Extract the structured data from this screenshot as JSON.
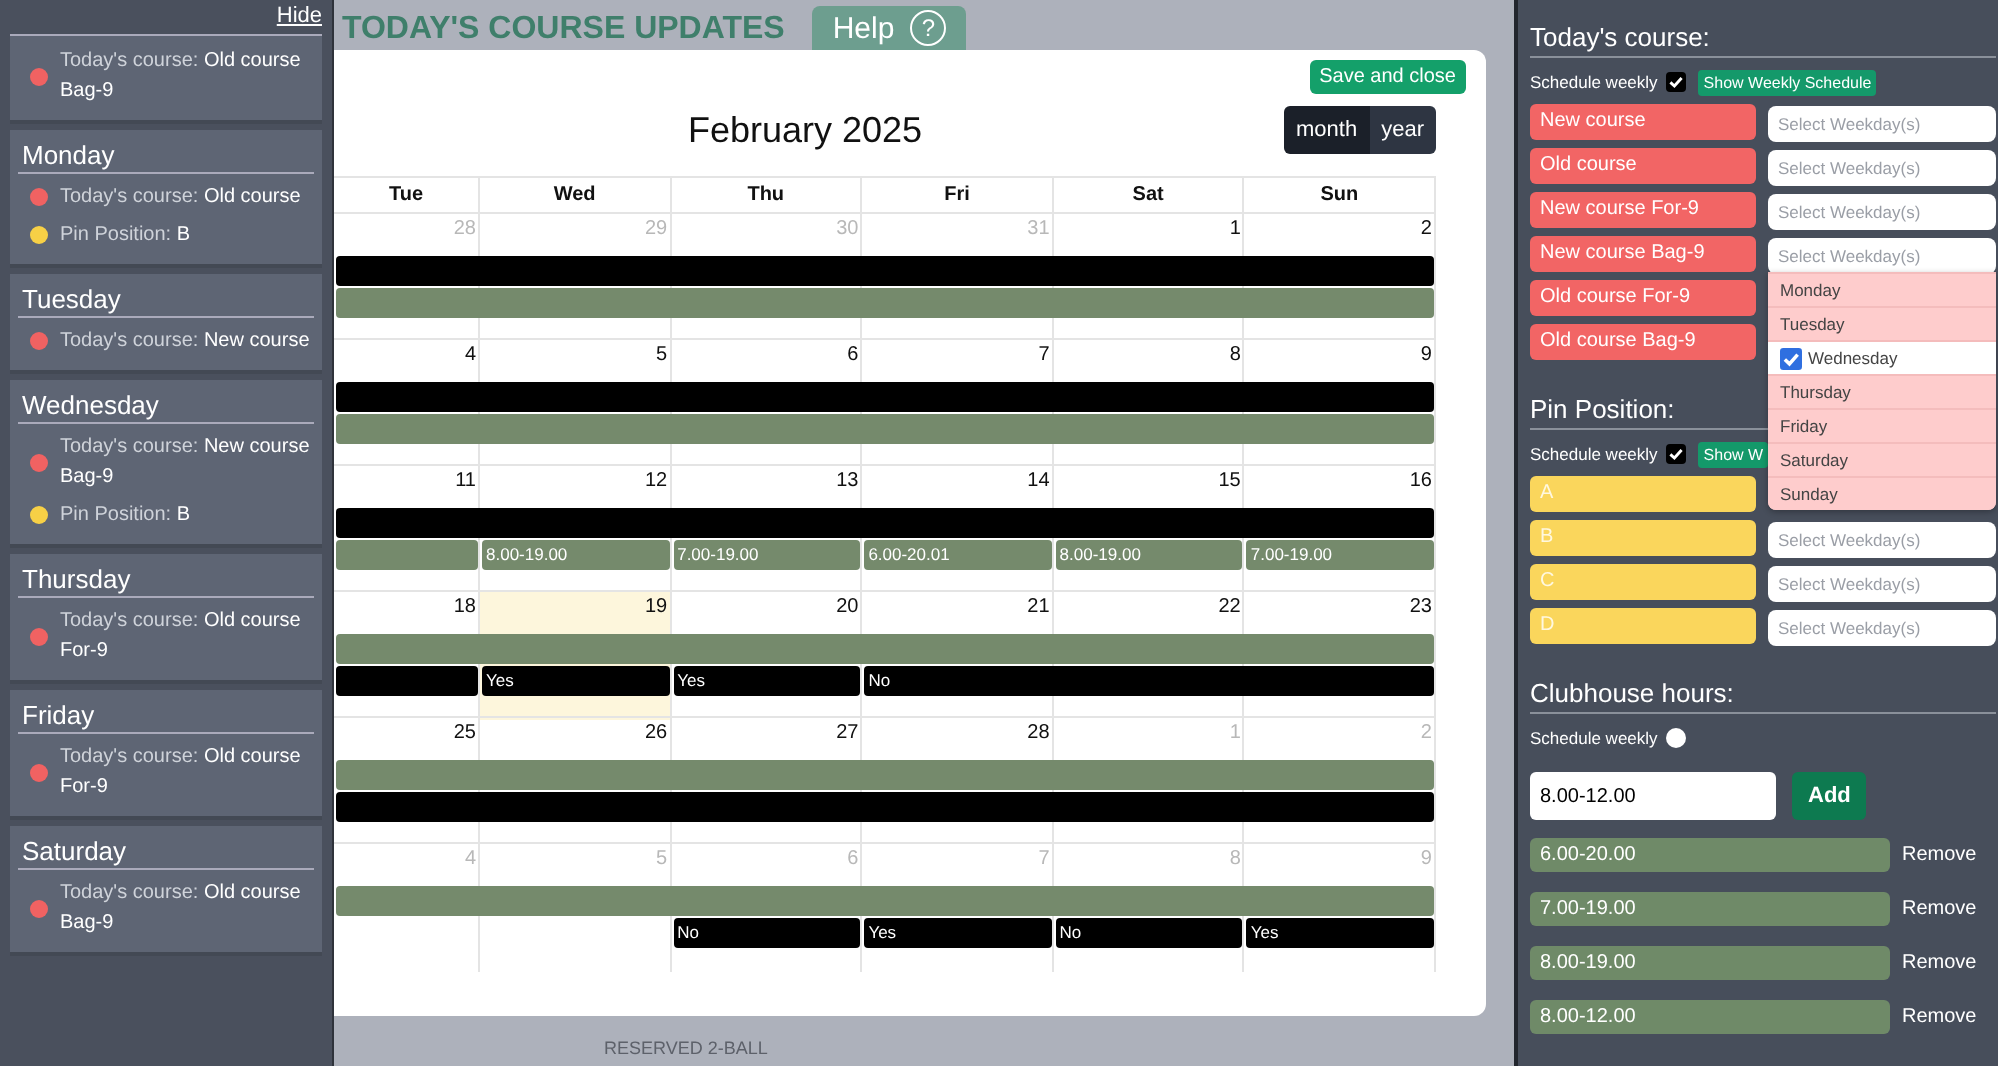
{
  "background": {
    "title": "TODAY'S COURSE UPDATES",
    "help_button": "Help",
    "help_icon": "?",
    "footer_text": "RESERVED 2-BALL"
  },
  "sidebar": {
    "hide_link": "Hide",
    "cards": [
      {
        "entries": [
          {
            "text": "Today's course: **Old course Bag-9**",
            "color": "#f06262"
          }
        ]
      },
      {
        "day": "Monday",
        "entries": [
          {
            "text": "Today's course: **Old course**",
            "color": "#f06262"
          },
          {
            "text": "Pin Position: **B**",
            "color": "#f7d046"
          }
        ]
      },
      {
        "day": "Tuesday",
        "entries": [
          {
            "text": "Today's course: **New course**",
            "color": "#f06262"
          }
        ]
      },
      {
        "day": "Wednesday",
        "entries": [
          {
            "text": "Today's course: **New course Bag-9**",
            "color": "#f06262"
          },
          {
            "text": "Pin Position: **B**",
            "color": "#f7d046"
          }
        ]
      },
      {
        "day": "Thursday",
        "entries": [
          {
            "text": "Today's course: **Old course For-9**",
            "color": "#f06262"
          }
        ]
      },
      {
        "day": "Friday",
        "entries": [
          {
            "text": "Today's course: **Old course For-9**",
            "color": "#f06262"
          }
        ]
      },
      {
        "day": "Saturday",
        "entries": [
          {
            "text": "Today's course: **Old course Bag-9**",
            "color": "#f06262"
          }
        ]
      }
    ]
  },
  "calendar": {
    "save_button": "Save and close",
    "title": "February 2025",
    "views": [
      {
        "label": "month",
        "selected": true
      },
      {
        "label": "year",
        "selected": false
      }
    ],
    "weekdays": [
      "Tue",
      "Wed",
      "Thu",
      "Fri",
      "Sat",
      "Sun"
    ],
    "weeks": [
      {
        "days": [
          {
            "number": "28",
            "muted": true,
            "today": false
          },
          {
            "number": "29",
            "muted": true,
            "today": false
          },
          {
            "number": "30",
            "muted": true,
            "today": false
          },
          {
            "number": "31",
            "muted": true,
            "today": false
          },
          {
            "number": "1",
            "muted": false,
            "today": false
          },
          {
            "number": "2",
            "muted": false,
            "today": false
          }
        ],
        "lanes": [
          [
            {
              "kind": "reserved"
            },
            {
              "kind": "reserved"
            },
            {
              "kind": "reserved"
            },
            {
              "kind": "reserved"
            },
            {
              "kind": "reserved"
            },
            {
              "kind": "reserved"
            }
          ],
          [
            {
              "kind": "hours"
            },
            {
              "kind": "hours"
            },
            {
              "kind": "hours"
            },
            {
              "kind": "hours"
            },
            {
              "kind": "hours"
            },
            {
              "kind": "hours"
            }
          ]
        ]
      },
      {
        "days": [
          {
            "number": "4",
            "muted": false,
            "today": false
          },
          {
            "number": "5",
            "muted": false,
            "today": false
          },
          {
            "number": "6",
            "muted": false,
            "today": false
          },
          {
            "number": "7",
            "muted": false,
            "today": false
          },
          {
            "number": "8",
            "muted": false,
            "today": false
          },
          {
            "number": "9",
            "muted": false,
            "today": false
          }
        ],
        "lanes": [
          [
            {
              "kind": "reserved"
            },
            {
              "kind": "reserved"
            },
            {
              "kind": "reserved"
            },
            {
              "kind": "reserved"
            },
            {
              "kind": "reserved"
            },
            {
              "kind": "reserved"
            }
          ],
          [
            {
              "kind": "hours"
            },
            {
              "kind": "hours"
            },
            {
              "kind": "hours"
            },
            {
              "kind": "hours"
            },
            {
              "kind": "hours"
            },
            {
              "kind": "hours"
            }
          ]
        ]
      },
      {
        "days": [
          {
            "number": "11",
            "muted": false,
            "today": false
          },
          {
            "number": "12",
            "muted": false,
            "today": false
          },
          {
            "number": "13",
            "muted": false,
            "today": false
          },
          {
            "number": "14",
            "muted": false,
            "today": false
          },
          {
            "number": "15",
            "muted": false,
            "today": false
          },
          {
            "number": "16",
            "muted": false,
            "today": false
          }
        ],
        "lanes": [
          [
            {
              "kind": "reserved"
            },
            {
              "kind": "reserved"
            },
            {
              "kind": "reserved"
            },
            {
              "kind": "reserved"
            },
            {
              "kind": "reserved"
            },
            {
              "kind": "reserved"
            }
          ],
          [
            {
              "kind": "hours"
            },
            {
              "kind": "hours",
              "text": "8.00-19.00"
            },
            {
              "kind": "hours",
              "text": "7.00-19.00"
            },
            {
              "kind": "hours",
              "text": "6.00-20.01"
            },
            {
              "kind": "hours",
              "text": "8.00-19.00"
            },
            {
              "kind": "hours",
              "text": "7.00-19.00"
            }
          ]
        ]
      },
      {
        "days": [
          {
            "number": "18",
            "muted": false,
            "today": false
          },
          {
            "number": "19",
            "muted": false,
            "today": true
          },
          {
            "number": "20",
            "muted": false,
            "today": false
          },
          {
            "number": "21",
            "muted": false,
            "today": false
          },
          {
            "number": "22",
            "muted": false,
            "today": false
          },
          {
            "number": "23",
            "muted": false,
            "today": false
          }
        ],
        "lanes": [
          [
            {
              "kind": "hours"
            },
            {
              "kind": "hours"
            },
            {
              "kind": "hours"
            },
            {
              "kind": "hours"
            },
            {
              "kind": "hours"
            },
            {
              "kind": "hours"
            }
          ],
          [
            {
              "kind": "reserved"
            },
            {
              "kind": "reserved",
              "text": "Yes"
            },
            {
              "kind": "reserved",
              "text": "Yes"
            },
            {
              "kind": "reserved",
              "text": "No"
            },
            {
              "kind": "reserved"
            },
            {
              "kind": "reserved"
            }
          ]
        ]
      },
      {
        "days": [
          {
            "number": "25",
            "muted": false,
            "today": false
          },
          {
            "number": "26",
            "muted": false,
            "today": false
          },
          {
            "number": "27",
            "muted": false,
            "today": false
          },
          {
            "number": "28",
            "muted": false,
            "today": false
          },
          {
            "number": "1",
            "muted": true,
            "today": false
          },
          {
            "number": "2",
            "muted": true,
            "today": false
          }
        ],
        "lanes": [
          [
            {
              "kind": "hours"
            },
            {
              "kind": "hours"
            },
            {
              "kind": "hours"
            },
            {
              "kind": "hours"
            },
            {
              "kind": "hours"
            },
            {
              "kind": "hours"
            }
          ],
          [
            {
              "kind": "reserved"
            },
            {
              "kind": "reserved"
            },
            {
              "kind": "reserved"
            },
            {
              "kind": "reserved"
            },
            {
              "kind": "reserved"
            },
            {
              "kind": "reserved"
            }
          ]
        ]
      },
      {
        "days": [
          {
            "number": "4",
            "muted": true,
            "today": false
          },
          {
            "number": "5",
            "muted": true,
            "today": false
          },
          {
            "number": "6",
            "muted": true,
            "today": false
          },
          {
            "number": "7",
            "muted": true,
            "today": false
          },
          {
            "number": "8",
            "muted": true,
            "today": false
          },
          {
            "number": "9",
            "muted": true,
            "today": false
          }
        ],
        "lanes": [
          [
            {
              "kind": "hours"
            },
            {
              "kind": "hours"
            },
            {
              "kind": "hours"
            },
            {
              "kind": "hours"
            },
            {
              "kind": "hours"
            },
            {
              "kind": "hours"
            }
          ],
          [
            {
              "kind": "empty"
            },
            {
              "kind": "empty"
            },
            {
              "kind": "reserved",
              "text": "No"
            },
            {
              "kind": "reserved",
              "text": "Yes"
            },
            {
              "kind": "reserved",
              "text": "No"
            },
            {
              "kind": "reserved",
              "text": "Yes"
            }
          ]
        ]
      }
    ]
  },
  "settings": {
    "sections": [
      {
        "kind": "course",
        "title": "Today's course:",
        "schedule_label": "Schedule weekly",
        "schedule_checked": true,
        "show_button": "Show Weekly Schedule",
        "rows": [
          {
            "name": "New course",
            "placeholder": "Select Weekday(s)"
          },
          {
            "name": "Old course",
            "placeholder": "Select Weekday(s)"
          },
          {
            "name": "New course For-9",
            "placeholder": "Select Weekday(s)"
          },
          {
            "name": "New course Bag-9",
            "placeholder": "Select Weekday(s)",
            "options": [
              {
                "label": "Monday",
                "checked": false
              },
              {
                "label": "Tuesday",
                "checked": false
              },
              {
                "label": "Wednesday",
                "checked": true
              },
              {
                "label": "Thursday",
                "checked": false
              },
              {
                "label": "Friday",
                "checked": false
              },
              {
                "label": "Saturday",
                "checked": false
              },
              {
                "label": "Sunday",
                "checked": false
              }
            ]
          },
          {
            "name": "Old course For-9"
          },
          {
            "name": "Old course Bag-9"
          }
        ]
      },
      {
        "kind": "pin",
        "title": "Pin Position:",
        "schedule_label": "Schedule weekly",
        "schedule_checked": true,
        "show_button": "Show W",
        "rows": [
          {
            "name": "A"
          },
          {
            "name": "B",
            "placeholder": "Select Weekday(s)"
          },
          {
            "name": "C",
            "placeholder": "Select Weekday(s)"
          },
          {
            "name": "D",
            "placeholder": "Select Weekday(s)"
          }
        ]
      },
      {
        "kind": "hours",
        "title": "Clubhouse hours:",
        "schedule_label": "Schedule weekly",
        "schedule_checked": false,
        "input_value": "8.00-12.00",
        "add_button": "Add",
        "hours": [
          {
            "text": "6.00-20.00",
            "action": "Remove"
          },
          {
            "text": "7.00-19.00",
            "action": "Remove"
          },
          {
            "text": "8.00-19.00",
            "action": "Remove"
          },
          {
            "text": "8.00-12.00",
            "action": "Remove"
          }
        ]
      }
    ]
  }
}
